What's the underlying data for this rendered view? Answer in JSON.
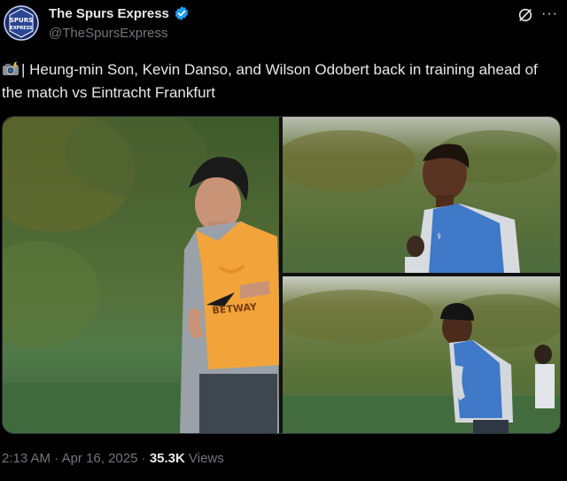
{
  "account": {
    "display_name": "The Spurs Express",
    "handle": "@TheSpursExpress",
    "avatar_text_1": "SPURS",
    "avatar_text_2": "EXPRESS",
    "verified_icon": "verified-badge-icon"
  },
  "tweet": {
    "emoji": "camera-with-flash-icon",
    "text": "| Heung-min Son, Kevin Danso, and Wilson Odobert back in training ahead of the match vs Eintracht Frankfurt"
  },
  "media": {
    "photo_1_shirt_text": "BETWAY",
    "photos": [
      "training-photo-son",
      "training-photo-danso",
      "training-photo-odobert"
    ]
  },
  "meta": {
    "time": "2:13 AM",
    "sep1": " · ",
    "date": "Apr 16, 2025",
    "sep2": " · ",
    "views_count": "35.3K",
    "views_label": " Views"
  },
  "colors": {
    "background": "#000000",
    "text": "#e7e9ea",
    "secondary_text": "#71767b",
    "verified": "#1d9bf0",
    "bib_orange": "#f2a43a",
    "bib_blue": "#3f79c8"
  }
}
